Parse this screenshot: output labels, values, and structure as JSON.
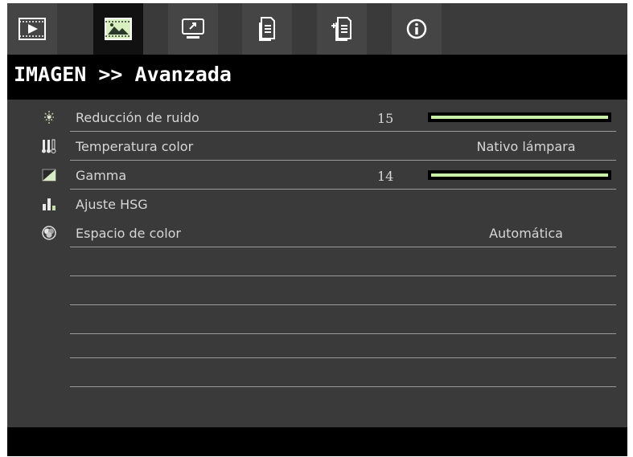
{
  "tabs": [
    {
      "icon": "video-play-icon",
      "active": false
    },
    {
      "icon": "image-icon",
      "active": true
    },
    {
      "icon": "display-icon",
      "active": false
    },
    {
      "icon": "settings-document-icon",
      "active": false
    },
    {
      "icon": "settings-documents-icon",
      "active": false
    },
    {
      "icon": "info-icon",
      "active": false
    }
  ],
  "header": {
    "title": "IMAGEN >> Avanzada"
  },
  "menu": [
    {
      "icon": "noise-reduction-icon",
      "label": "Reducción de ruido",
      "number": "15",
      "slider_percent": 1.0,
      "value": ""
    },
    {
      "icon": "thermometer-icon",
      "label": "Temperatura color",
      "number": "",
      "value": "Nativo lámpara"
    },
    {
      "icon": "gamma-icon",
      "label": "Gamma",
      "number": "14",
      "slider_percent": 1.0,
      "value": ""
    },
    {
      "icon": "hsg-bars-icon",
      "label": "Ajuste HSG",
      "number": "",
      "value": ""
    },
    {
      "icon": "color-space-icon",
      "label": "Espacio de color",
      "number": "",
      "value": "Automática"
    }
  ],
  "colors": {
    "slider_fill": "#c8f0a8",
    "active_tab": "#111111",
    "text": "#d6d6d6"
  }
}
